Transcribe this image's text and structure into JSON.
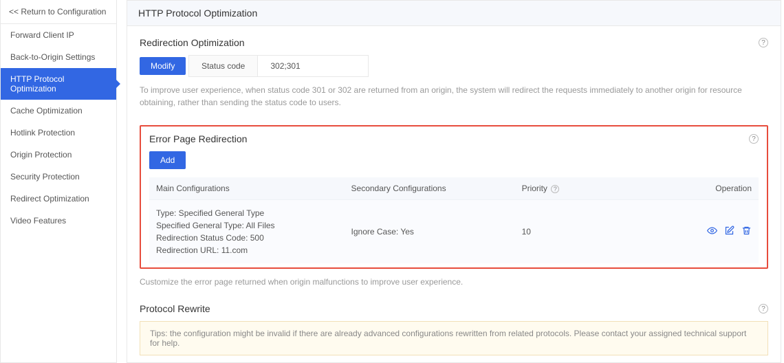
{
  "sidebar": {
    "return_label": "<< Return to Configuration",
    "items": [
      {
        "label": "Forward Client IP"
      },
      {
        "label": "Back-to-Origin Settings"
      },
      {
        "label": "HTTP Protocol Optimization"
      },
      {
        "label": "Cache Optimization"
      },
      {
        "label": "Hotlink Protection"
      },
      {
        "label": "Origin Protection"
      },
      {
        "label": "Security Protection"
      },
      {
        "label": "Redirect Optimization"
      },
      {
        "label": "Video Features"
      }
    ],
    "active_index": 2
  },
  "page_title": "HTTP Protocol Optimization",
  "redirection_opt": {
    "title": "Redirection Optimization",
    "modify_label": "Modify",
    "status_label": "Status code",
    "status_value": "302;301",
    "desc": "To improve user experience, when status code 301 or 302 are returned from an origin, the system will redirect the requests immediately to another origin for resource obtaining, rather than sending the status code to users."
  },
  "error_redir": {
    "title": "Error Page Redirection",
    "add_label": "Add",
    "columns": {
      "main": "Main Configurations",
      "secondary": "Secondary Configurations",
      "priority": "Priority",
      "operation": "Operation"
    },
    "row": {
      "type_line": "Type: Specified General Type",
      "general_line": "Specified General Type: All Files",
      "status_line": "Redirection Status Code: 500",
      "url_line": "Redirection URL: 11.com",
      "secondary": "Ignore Case: Yes",
      "priority": "10"
    },
    "desc": "Customize the error page returned when origin malfunctions to improve user experience."
  },
  "protocol_rewrite": {
    "title": "Protocol Rewrite",
    "tips": "Tips: the configuration might be invalid if there are already advanced configurations rewritten from related protocols. Please contact your assigned technical support for help."
  }
}
